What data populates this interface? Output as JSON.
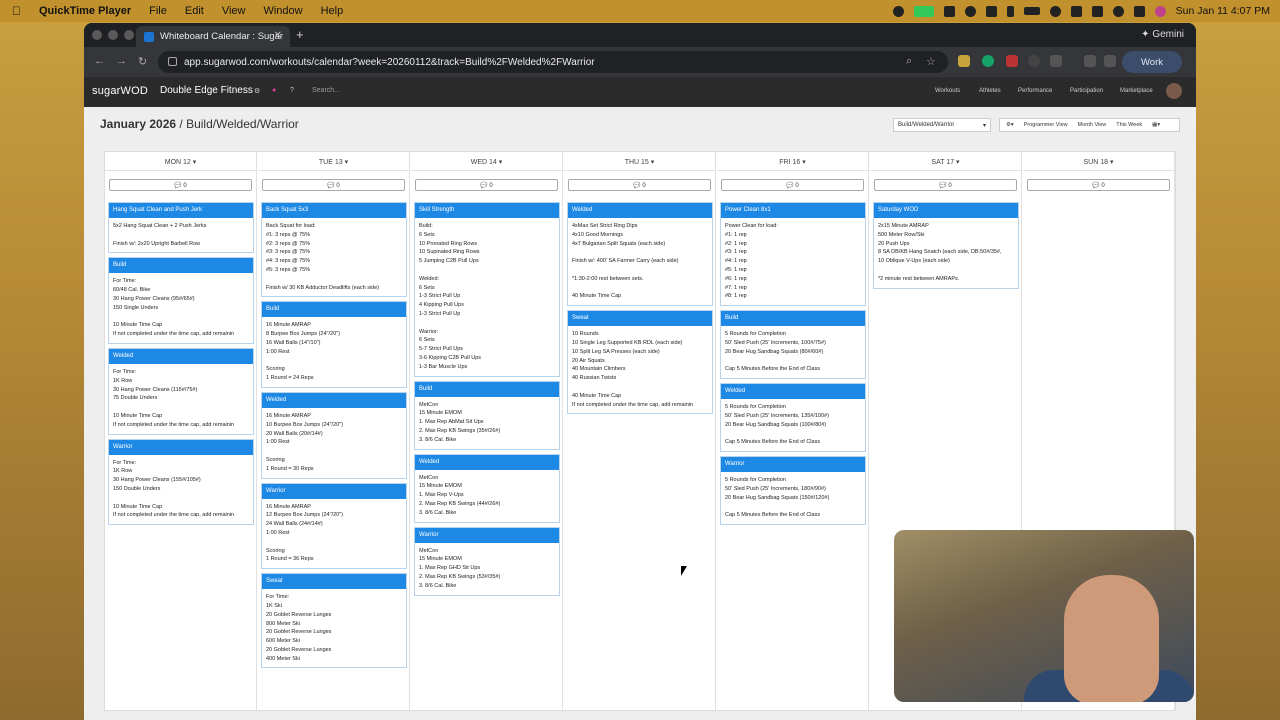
{
  "menubar": {
    "app_name": "QuickTime Player",
    "items": [
      "File",
      "Edit",
      "View",
      "Window",
      "Help"
    ],
    "clock": "Sun Jan 11  4:07 PM"
  },
  "browser": {
    "tab_title": "Whiteboard Calendar : Sugar",
    "gemini_label": "Gemini",
    "url": "app.sugarwod.com/workouts/calendar?week=20260112&track=Build%2FWelded%2FWarrior",
    "profile_label": "Work"
  },
  "app": {
    "logo_text": "sugarWOD",
    "gym_name": "Double Edge Fitness",
    "search_placeholder": "Search...",
    "nav": [
      "Workouts",
      "Athletes",
      "Performance",
      "Participation",
      "Marketplace"
    ]
  },
  "page": {
    "title_month": "January 2026",
    "title_track": "/ Build/Welded/Warrior",
    "track_select": "Build/Welded/Warrior",
    "programmer_view": "Programmer View",
    "month_view": "Month View",
    "this_week": "This Week"
  },
  "days": [
    {
      "label": "MON 12",
      "comments": "0",
      "cards": [
        {
          "title": "Hang Squat Clean and Push Jerk",
          "body": "5x2 Hang Squat Clean + 2 Push Jerks\n\nFinish w/: 2x20 Upright Barbell Row"
        },
        {
          "title": "Build",
          "body": "For Time:\n60/48 Cal. Bike\n30 Hang Power Cleans (95#/65#)\n150 Single Unders\n\n10 Minute Time Cap\nIf not completed under the time cap, add remainin"
        },
        {
          "title": "Welded",
          "body": "For Time:\n1K Row\n30 Hang Power Cleans (115#/75#)\n75 Double Unders\n\n10 Minute Time Cap\nIf not completed under the time cap, add remainin"
        },
        {
          "title": "Warrior",
          "body": "For Time:\n1K Row\n30 Hang Power Cleans (155#/105#)\n150 Double Unders\n\n10 Minute Time Cap\nIf not completed under the time cap, add remainin"
        }
      ]
    },
    {
      "label": "TUE 13",
      "comments": "0",
      "cards": [
        {
          "title": "Back Squat 5x3",
          "body": "Back Squat for load:\n#1: 3 reps @ 75%\n#2: 3 reps @ 75%\n#3: 3 reps @ 75%\n#4: 3 reps @ 75%\n#5: 3 reps @ 75%\n\nFinish w/ 30 KB Adductor Deadlifts (each side)"
        },
        {
          "title": "Build",
          "body": "16 Minute AMRAP\n8 Burpee Box Jumps (24\"/20\")\n16 Wall Balls (14\"/10\")\n1:00 Rest\n\nScoring\n1 Round = 24 Reps"
        },
        {
          "title": "Welded",
          "body": "16 Minute AMRAP\n10 Burpee Box Jumps (24\"/20\")\n20 Wall Balls (20#/14#)\n1:00 Rest\n\nScoring\n1 Round = 30 Reps"
        },
        {
          "title": "Warrior",
          "body": "16 Minute AMRAP\n12 Burpee Box Jumps (24\"/20\")\n24 Wall Balls (24#/14#)\n1:00 Rest\n\nScoring\n1 Round = 36 Reps"
        },
        {
          "title": "Sweat",
          "body": "For Time:\n1K Ski\n20 Goblet Reverse Lunges\n800 Meter Ski\n20 Goblet Reverse Lunges\n600 Meter Ski\n20 Goblet Reverse Lunges\n400 Meter Ski"
        }
      ]
    },
    {
      "label": "WED 14",
      "comments": "0",
      "cards": [
        {
          "title": "Skill Strength",
          "body": "Build:\n6 Sets\n10 Pronated Ring Rows\n10 Supinated Ring Rows\n5 Jumping C2B Pull Ups\n\nWelded:\n6 Sets\n1-3 Strict Pull Up\n4 Kipping Pull Ups\n1-3 Strict Pull Up\n\nWarrior:\n6 Sets\n5-7 Strict Pull Ups\n3-6 Kipping C2B Pull Ups\n1-3 Bar Muscle Ups"
        },
        {
          "title": "Build",
          "body": "MetCon\n15 Minute EMOM\n1. Max Rep AbMat Sit Ups\n2. Max Rep KB Swings (35#/26#)\n3. 8/6 Cal. Bike"
        },
        {
          "title": "Welded",
          "body": "MetCon\n15 Minute EMOM\n1. Max Rep V-Ups\n2. Max Rep KB Swings (44#/26#)\n3. 8/6 Cal. Bike"
        },
        {
          "title": "Warrior",
          "body": "MetCon\n15 Minute EMOM\n1. Max Rep GHD Sit Ups\n2. Max Rep KB Swings (53#/35#)\n3. 8/6 Cal. Bike"
        }
      ]
    },
    {
      "label": "THU 15",
      "comments": "0",
      "cards": [
        {
          "title": "Welded",
          "body": "4xMax Set Strict Ring Dips\n4x10 Good Mornings\n4x7 Bulgarian Split Squats (each side)\n\nFinish w/: 400' SA Farmer Carry (each side)\n\n*1:30-2:00 rest between sets.\n\n40 Minute Time Cap"
        },
        {
          "title": "Sweat",
          "body": "10 Rounds\n10 Single Leg Supported KB RDL (each side)\n10 Split Leg SA Presses (each side)\n20 Air Squats\n40 Mountain Climbers\n40 Russian Twists\n\n40 Minute Time Cap\nIf not completed under the time cap, add remainin"
        }
      ]
    },
    {
      "label": "FRI 16",
      "comments": "0",
      "cards": [
        {
          "title": "Power Clean 8x1",
          "body": "Power Clean for load:\n#1: 1 rep\n#2: 1 rep\n#3: 1 rep\n#4: 1 rep\n#5: 1 rep\n#6: 1 rep\n#7: 1 rep\n#8: 1 rep"
        },
        {
          "title": "Build",
          "body": "5 Rounds for Completion\n50' Sled Push (25' Increments, 100#/75#)\n20 Bear Hug Sandbag Squats (80#/60#)\n\nCap 5 Minutes Before the End of Class"
        },
        {
          "title": "Welded",
          "body": "5 Rounds for Completion\n50' Sled Push (25' Increments, 135#/100#)\n20 Bear Hug Sandbag Squats (100#/80#)\n\nCap 5 Minutes Before the End of Class"
        },
        {
          "title": "Warrior",
          "body": "5 Rounds for Completion\n50' Sled Push (25' Increments, 180#/90#)\n20 Bear Hug Sandbag Squats (150#/120#)\n\nCap 5 Minutes Before the End of Class"
        }
      ]
    },
    {
      "label": "SAT 17",
      "comments": "0",
      "cards": [
        {
          "title": "Saturday WOD",
          "body": "2x15 Minute AMRAP\n500 Meter Row/Ski\n20 Push Ups\n8 SA DB/KB Hang Snatch (each side, DB:50#/35#,\n10 Oblique V-Ups (each side)\n\n*2 minute rest between AMRAPs."
        }
      ]
    },
    {
      "label": "SUN 18",
      "comments": "0",
      "cards": []
    }
  ]
}
